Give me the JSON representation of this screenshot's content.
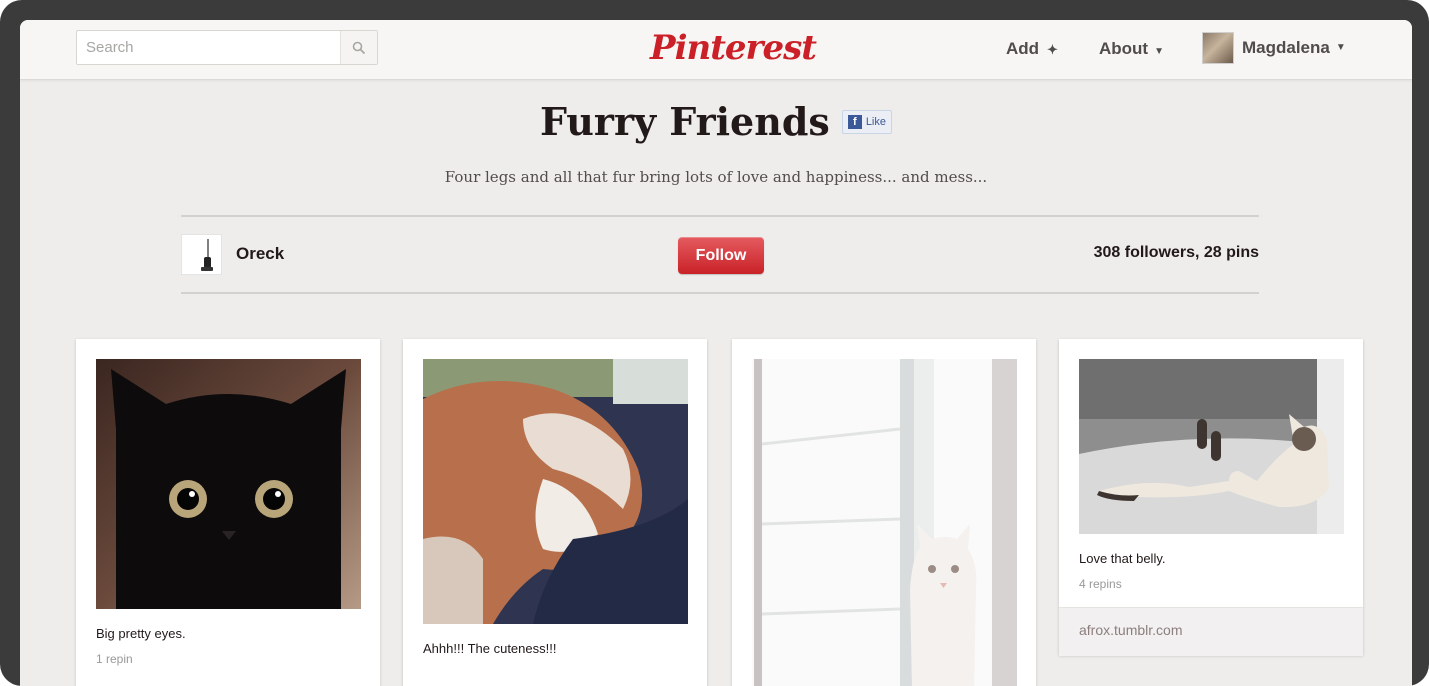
{
  "header": {
    "search_placeholder": "Search",
    "logo": "Pinterest",
    "nav": {
      "add": "Add",
      "about": "About",
      "user": "Magdalena"
    },
    "icons": {
      "search": "search-icon",
      "add": "plus-icon",
      "about": "caret-down-icon",
      "user": "caret-down-icon"
    }
  },
  "board": {
    "title": "Furry Friends",
    "like_label": "Like",
    "description": "Four legs and all that fur bring lots of love and happiness... and mess...",
    "owner": "Oreck",
    "follow_label": "Follow",
    "stats": "308 followers, 28 pins"
  },
  "pins": [
    {
      "description": "Big pretty eyes.",
      "repins": "1 repin"
    },
    {
      "description": "Ahhh!!! The cuteness!!!"
    },
    {
      "description": ""
    },
    {
      "description": "Love that belly.",
      "repins": "4 repins",
      "source": "afrox.tumblr.com"
    }
  ],
  "colors": {
    "brand_red": "#cb2027",
    "background": "#efedeb",
    "frame": "#3b3b3b"
  }
}
